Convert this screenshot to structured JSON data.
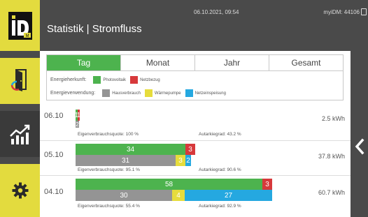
{
  "header": {
    "timestamp": "06.10.2021, 09:54",
    "device": "myiDM: 44106",
    "title": "Statistik | Stromfluss"
  },
  "sidebar": {
    "logo_text": "iD",
    "logo_sub": "M"
  },
  "tabs": [
    {
      "label": "Tag",
      "active": true
    },
    {
      "label": "Monat",
      "active": false
    },
    {
      "label": "Jahr",
      "active": false
    },
    {
      "label": "Gesamt",
      "active": false
    }
  ],
  "legend": {
    "source_label": "Energieherkunft:",
    "source_items": [
      {
        "label": "Photovoltaik",
        "color": "#4db34e"
      },
      {
        "label": "Netzbezug",
        "color": "#d7393b"
      }
    ],
    "use_label": "Energieverwendung:",
    "use_items": [
      {
        "label": "Hausverbrauch",
        "color": "#949494"
      },
      {
        "label": "Wärmepumpe",
        "color": "#e6dc3c"
      },
      {
        "label": "Netzeinspeisung",
        "color": "#25a8e0"
      }
    ]
  },
  "days": [
    {
      "date": "06.10",
      "total": "2.5 kWh",
      "pv": "1",
      "grid": "1",
      "house": "2",
      "heat": "",
      "feed": "",
      "self_use": "Eigenverbrauchsquote: 100 %",
      "autarky": "Autarkiegrad: 43.2 %"
    },
    {
      "date": "05.10",
      "total": "37.8 kWh",
      "pv": "34",
      "grid": "3",
      "house": "31",
      "heat": "3",
      "feed": "2",
      "self_use": "Eigenverbrauchsquote: 95.1 %",
      "autarky": "Autarkiegrad: 90.6 %"
    },
    {
      "date": "04.10",
      "total": "60.7 kWh",
      "pv": "58",
      "grid": "3",
      "house": "30",
      "heat": "4",
      "feed": "27",
      "self_use": "Eigenverbrauchsquote: 55.4 %",
      "autarky": "Autarkiegrad: 92.9 %"
    }
  ]
}
